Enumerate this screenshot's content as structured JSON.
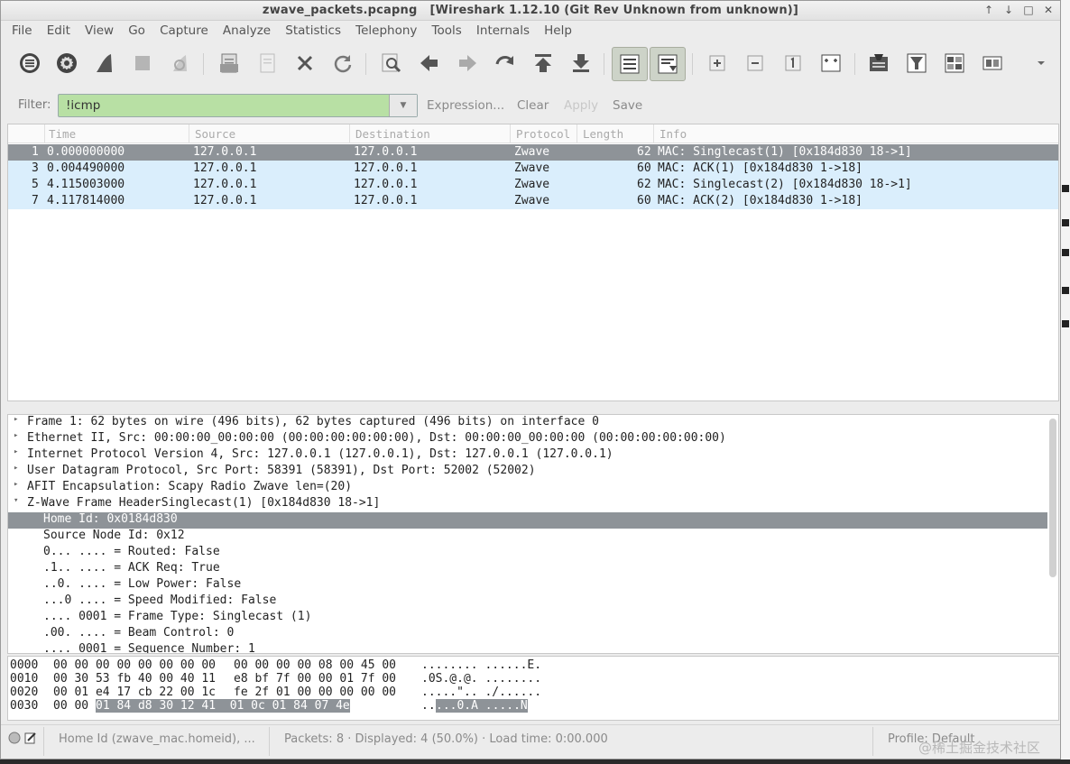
{
  "window": {
    "filename": "zwave_packets.pcapng",
    "app": "[Wireshark 1.12.10  (Git Rev Unknown from unknown)]",
    "controls": [
      "↑",
      "↓",
      "□",
      "✕"
    ]
  },
  "menu": [
    "File",
    "Edit",
    "View",
    "Go",
    "Capture",
    "Analyze",
    "Statistics",
    "Telephony",
    "Tools",
    "Internals",
    "Help"
  ],
  "toolbar": {
    "icons": [
      "interfaces-icon",
      "options-icon",
      "start-capture-icon",
      "stop-capture-icon",
      "restart-capture-icon",
      "open-file-icon",
      "save-file-icon",
      "close-file-icon",
      "reload-icon",
      "find-packet-icon",
      "go-back-icon",
      "go-forward-icon",
      "go-to-packet-icon",
      "go-to-first-icon",
      "go-to-last-icon",
      "colorize-icon",
      "autoscroll-icon",
      "zoom-in-icon",
      "zoom-out-icon",
      "normal-size-icon",
      "resize-columns-icon",
      "capture-filters-icon",
      "display-filters-icon",
      "coloring-rules-icon",
      "preferences-icon",
      "more-icon"
    ]
  },
  "filter": {
    "label": "Filter:",
    "value": "!icmp",
    "buttons": [
      "Expression...",
      "Clear",
      "Apply",
      "Save"
    ]
  },
  "packet_list": {
    "columns": [
      "Time",
      "Source",
      "Destination",
      "Protocol",
      "Length",
      "Info"
    ],
    "rows": [
      {
        "no": "1",
        "time": "0.000000000",
        "src": "127.0.0.1",
        "dst": "127.0.0.1",
        "proto": "Zwave",
        "len": "62",
        "info": "MAC: Singlecast(1) [0x184d830 18->1]"
      },
      {
        "no": "3",
        "time": "0.004490000",
        "src": "127.0.0.1",
        "dst": "127.0.0.1",
        "proto": "Zwave",
        "len": "60",
        "info": "MAC: ACK(1) [0x184d830 1->18]"
      },
      {
        "no": "5",
        "time": "4.115003000",
        "src": "127.0.0.1",
        "dst": "127.0.0.1",
        "proto": "Zwave",
        "len": "62",
        "info": "MAC: Singlecast(2) [0x184d830 18->1]"
      },
      {
        "no": "7",
        "time": "4.117814000",
        "src": "127.0.0.1",
        "dst": "127.0.0.1",
        "proto": "Zwave",
        "len": "60",
        "info": "MAC: ACK(2) [0x184d830 1->18]"
      }
    ]
  },
  "details": {
    "rows": [
      {
        "exp": "▸",
        "text": "Frame 1: 62 bytes on wire (496 bits), 62 bytes captured (496 bits) on interface 0"
      },
      {
        "exp": "▸",
        "text": "Ethernet II, Src: 00:00:00_00:00:00 (00:00:00:00:00:00), Dst: 00:00:00_00:00:00 (00:00:00:00:00:00)"
      },
      {
        "exp": "▸",
        "text": "Internet Protocol Version 4, Src: 127.0.0.1 (127.0.0.1), Dst: 127.0.0.1 (127.0.0.1)"
      },
      {
        "exp": "▸",
        "text": "User Datagram Protocol, Src Port: 58391 (58391), Dst Port: 52002 (52002)"
      },
      {
        "exp": "▸",
        "text": "AFIT Encapsulation: Scapy Radio Zwave len=(20)"
      },
      {
        "exp": "▾",
        "text": "Z-Wave Frame HeaderSinglecast(1) [0x184d830 18->1]"
      },
      {
        "exp": "",
        "text": "Home Id: 0x0184d830"
      },
      {
        "exp": "",
        "text": "Source Node Id: 0x12"
      },
      {
        "exp": "",
        "text": "0... .... = Routed: False"
      },
      {
        "exp": "",
        "text": ".1.. .... = ACK Req: True"
      },
      {
        "exp": "",
        "text": "..0. .... = Low Power: False"
      },
      {
        "exp": "",
        "text": "...0 .... = Speed Modified: False"
      },
      {
        "exp": "",
        "text": ".... 0001 = Frame Type: Singlecast (1)"
      },
      {
        "exp": "",
        "text": ".00. .... = Beam Control: 0"
      },
      {
        "exp": "",
        "text": ".... 0001 = Sequence Number: 1"
      }
    ]
  },
  "bytes": {
    "rows": [
      {
        "off": "0000",
        "hex_a": "00 00 00 00 00 00 00 00",
        "hex_b": "00 00 00 00 08 00 45 00",
        "hex_hl": "",
        "asc_a": "........ ......E.",
        "asc_hl": ""
      },
      {
        "off": "0010",
        "hex_a": "00 30 53 fb 40 00 40 11",
        "hex_b": "e8 bf 7f 00 00 01 7f 00",
        "hex_hl": "",
        "asc_a": ".0S.@.@. ........",
        "asc_hl": ""
      },
      {
        "off": "0020",
        "hex_a": "00 01 e4 17 cb 22 00 1c",
        "hex_b": "fe 2f 01 00 00 00 00 00",
        "hex_hl": "",
        "asc_a": ".....\".. ./......",
        "asc_hl": ""
      },
      {
        "off": "0030",
        "hex_a": "00 00 ",
        "hex_b": "",
        "hex_hl": "01 84 d8 30 12 41  01 0c 01 84 07 4e",
        "asc_a": "..",
        "asc_hl": "...0.A .....N"
      }
    ]
  },
  "status": {
    "field": "Home Id (zwave_mac.homeid), ...",
    "packets": "Packets: 8 · Displayed: 4 (50.0%) · Load time: 0:00.000",
    "profile": "Profile: Default"
  },
  "watermark": "@稀土掘金技术社区"
}
